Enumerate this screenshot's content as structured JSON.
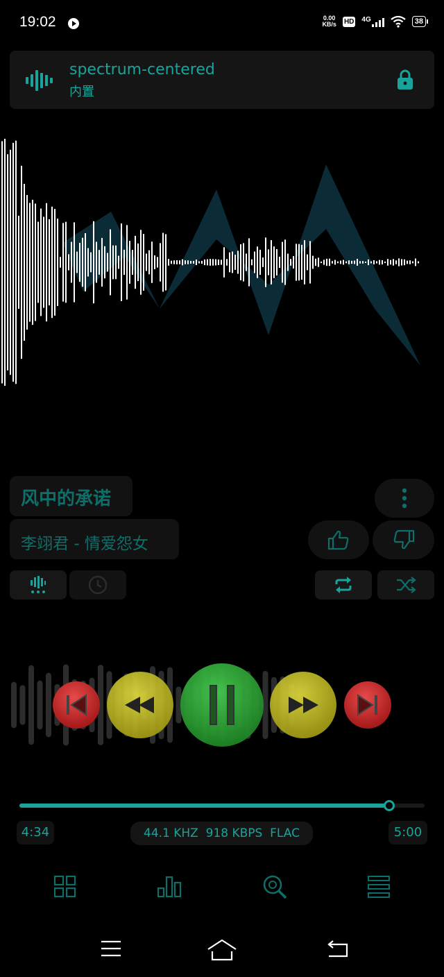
{
  "status_bar": {
    "time": "19:02",
    "net_speed_value": "0.00",
    "net_speed_unit": "KB/s",
    "hd": "HD",
    "network": "4G",
    "battery": "38"
  },
  "preset": {
    "name": "spectrum-centered",
    "type": "内置"
  },
  "song": {
    "title": "风中的承诺",
    "artist_album": "李翊君 - 情爱怨女"
  },
  "player": {
    "elapsed": "4:34",
    "total": "5:00",
    "progress": 0.91,
    "format": "44.1 KHZ  918 KBPS  FLAC",
    "state": "playing"
  },
  "colors": {
    "accent": "#1aa39a",
    "dim_accent": "#0e6e69",
    "background": "#000000",
    "panel": "#151515",
    "prev_next": "#d42a2a",
    "seek": "#c8c21e",
    "pause": "#2fae3a"
  },
  "icons": {
    "preset": "waveform-icon",
    "lock": "lock-icon",
    "menu": "more-vertical-icon",
    "like": "thumbs-up-icon",
    "dislike": "thumbs-down-icon",
    "visualizer": "visualizer-icon",
    "timer": "clock-icon",
    "repeat": "repeat-icon",
    "shuffle": "shuffle-icon",
    "nav": [
      "grid-icon",
      "bar-chart-icon",
      "search-icon",
      "list-icon"
    ],
    "system": [
      "menu-icon",
      "home-icon",
      "back-icon"
    ]
  }
}
